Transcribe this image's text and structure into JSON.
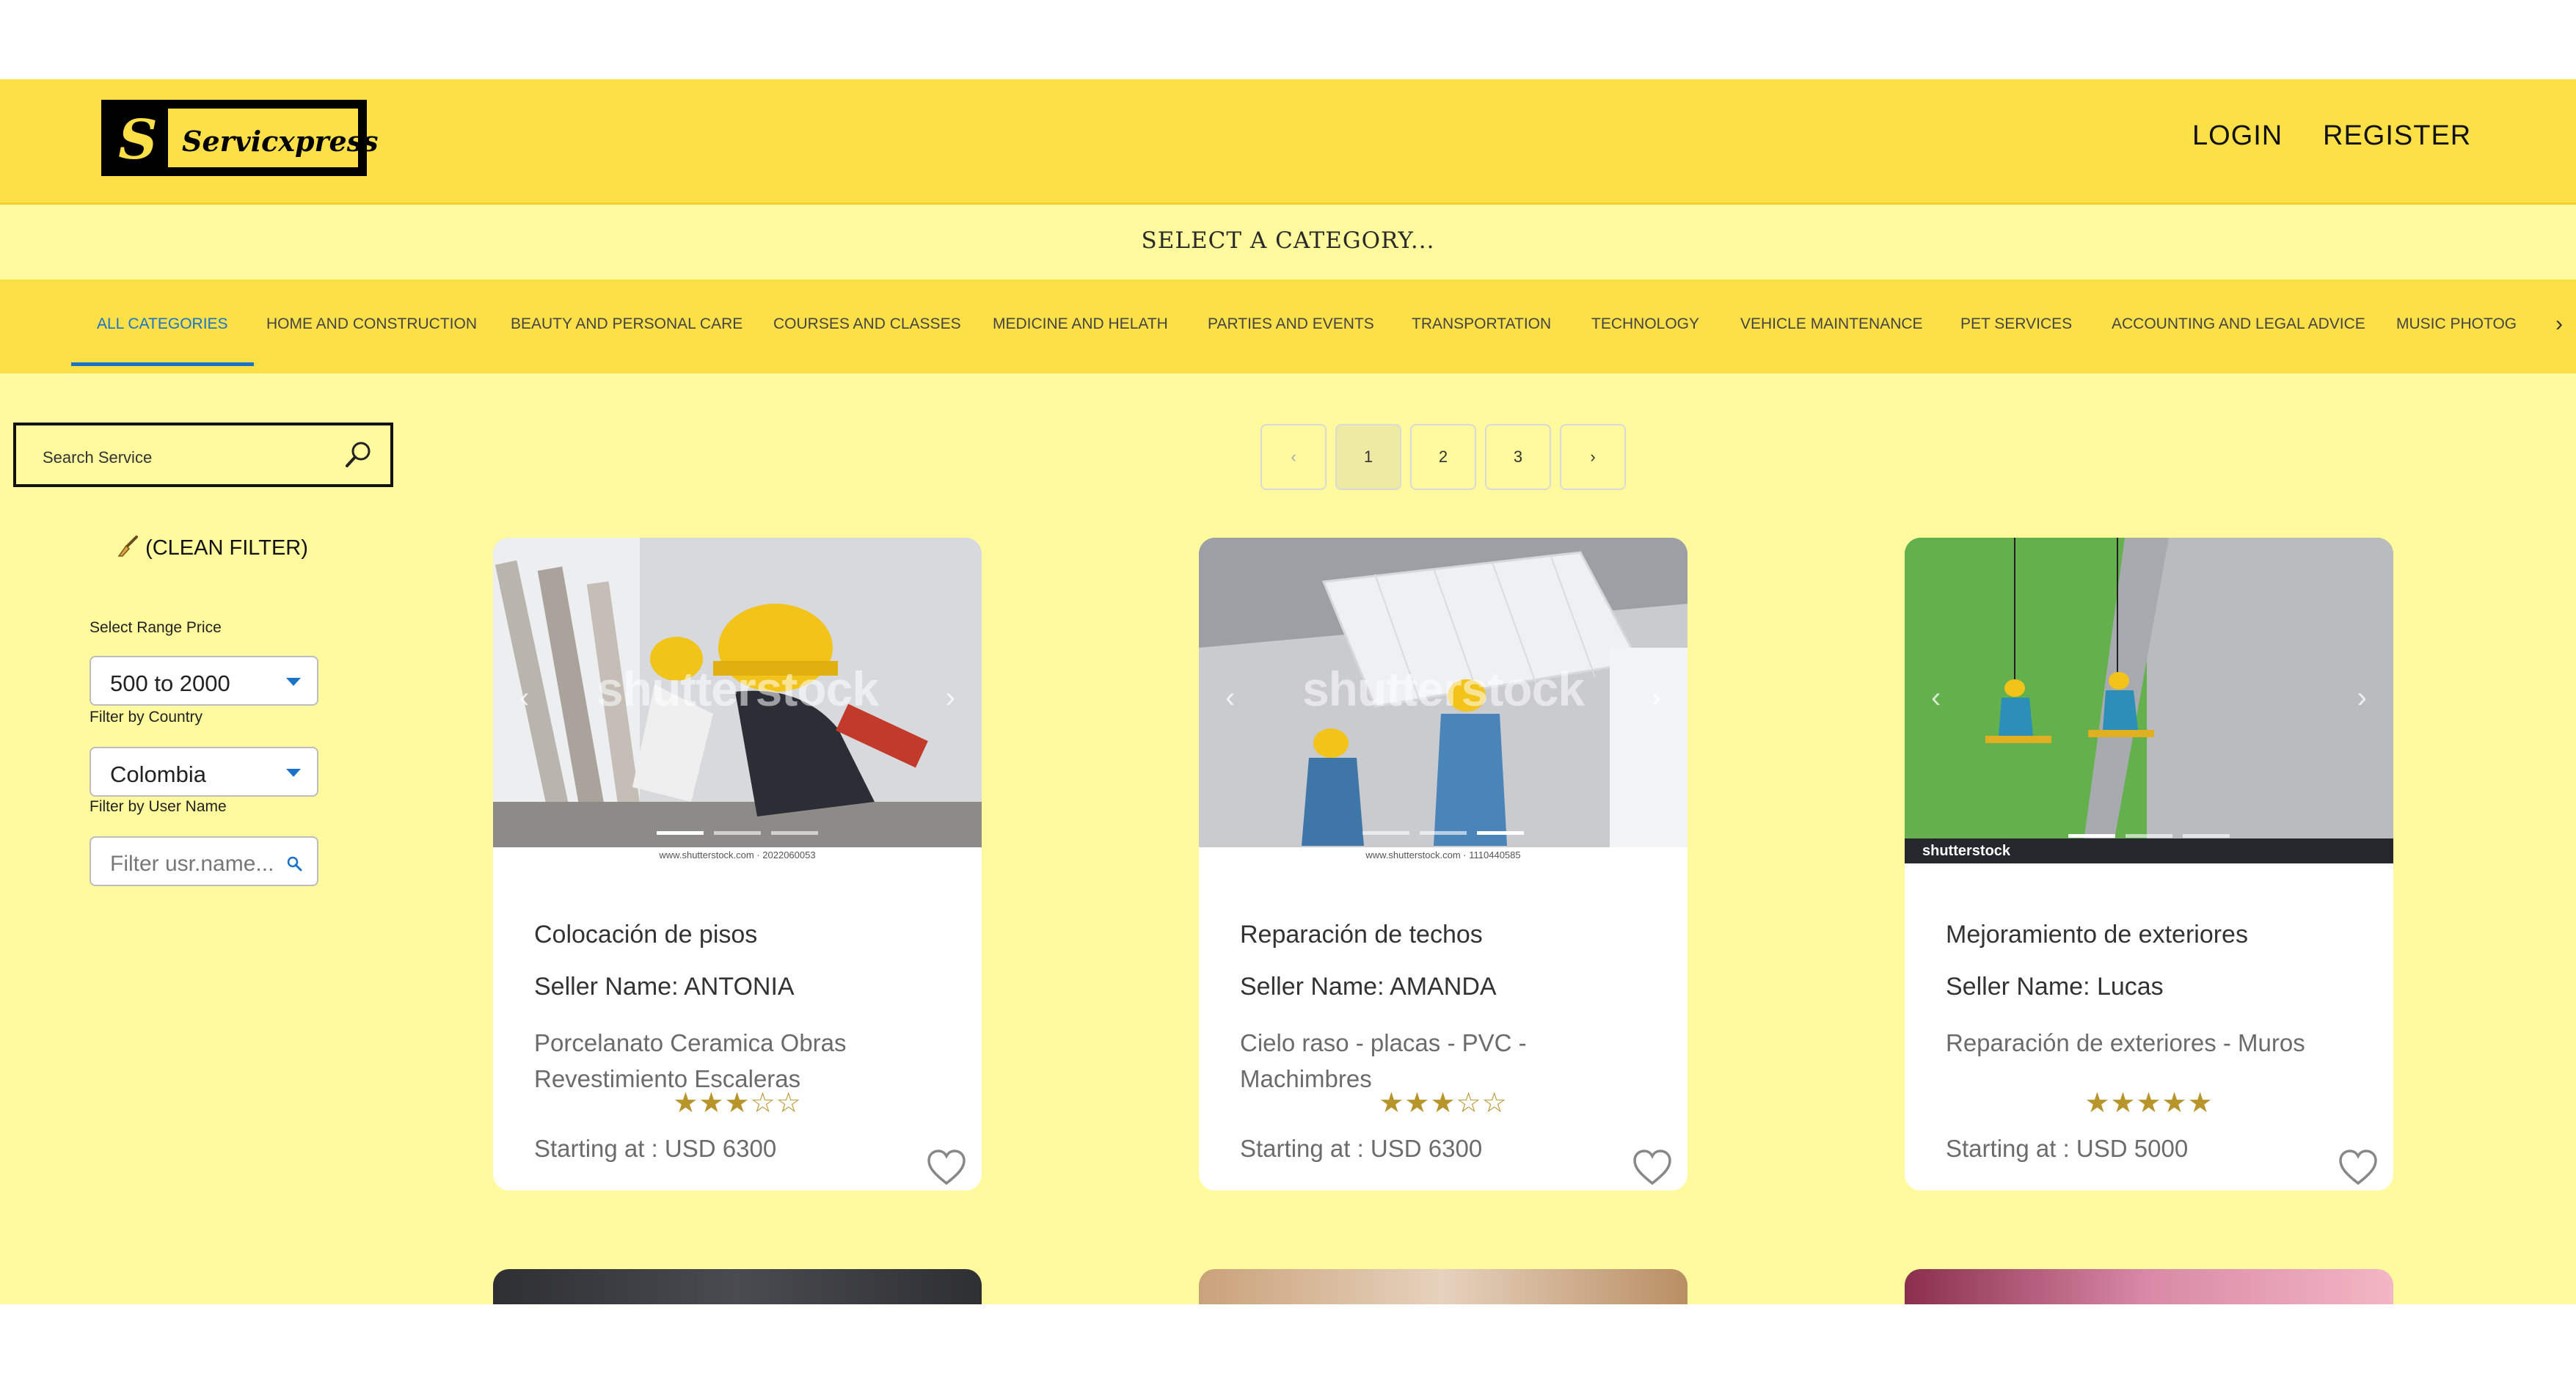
{
  "header": {
    "logo_letter": "S",
    "logo_text": "Servicxpress",
    "login_label": "LOGIN",
    "register_label": "REGISTER"
  },
  "categories": {
    "prompt": "SELECT A CATEGORY...",
    "tabs": [
      "ALL CATEGORIES",
      "HOME AND CONSTRUCTION",
      "BEAUTY AND PERSONAL CARE",
      "COURSES AND CLASSES",
      "MEDICINE AND HELATH",
      "PARTIES AND EVENTS",
      "TRANSPORTATION",
      "TECHNOLOGY",
      "VEHICLE MAINTENANCE",
      "PET SERVICES",
      "ACCOUNTING AND LEGAL ADVICE",
      "MUSIC PHOTOG"
    ],
    "active_index": 0,
    "next_icon": "›"
  },
  "sidebar": {
    "search_placeholder": "Search Service",
    "clean_filter_label": "(CLEAN FILTER)",
    "range_label": "Select Range Price",
    "range_value": "500 to 2000",
    "country_label": "Filter by Country",
    "country_value": "Colombia",
    "username_label": "Filter by User Name",
    "username_placeholder": "Filter usr.name..."
  },
  "pagination": {
    "prev": "‹",
    "pages": [
      "1",
      "2",
      "3"
    ],
    "current": "1",
    "next": "›"
  },
  "cards": [
    {
      "title": "Colocación de pisos",
      "seller": "Seller Name: ANTONIA",
      "description": "Porcelanato Ceramica Obras Revestimiento Escaleras",
      "rating": 3,
      "rating_stars": "★★★☆☆",
      "price": "Starting at : USD 6300",
      "watermark": "shutterstock",
      "caption": "www.shutterstock.com · 2022060053"
    },
    {
      "title": "Reparación de techos",
      "seller": "Seller Name: AMANDA",
      "description": "Cielo raso - placas - PVC - Machimbres",
      "rating": 3,
      "rating_stars": "★★★☆☆",
      "price": "Starting at : USD 6300",
      "watermark": "shutterstock",
      "caption": "www.shutterstock.com · 1110440585"
    },
    {
      "title": "Mejoramiento de exteriores",
      "seller": "Seller Name: Lucas",
      "description": "Reparación de exteriores - Muros",
      "rating": 5,
      "rating_stars": "★★★★★",
      "price": "Starting at : USD 5000",
      "watermark": "",
      "caption": "shutterstock"
    }
  ],
  "colors": {
    "header_bg": "#fde047",
    "page_bg": "#fffa9e",
    "accent_blue": "#1a73c9",
    "star_gold": "#b8952b"
  },
  "icons": {
    "search": "search-icon",
    "broom": "broom-icon",
    "heart": "heart-outline-icon",
    "dropdown": "caret-down-icon"
  }
}
